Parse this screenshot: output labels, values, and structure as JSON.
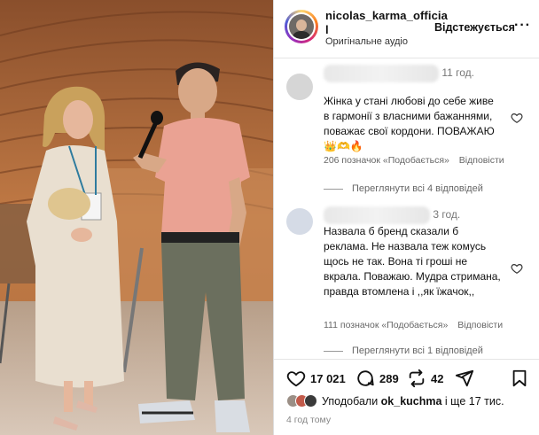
{
  "header": {
    "username": "nicolas_karma_officia l",
    "audio": "Оригінальне аудіо",
    "follow_label": "Відстежується",
    "more_icon": "more-dots-icon"
  },
  "comments": [
    {
      "time": "11 год.",
      "text": "Жінка у стані любові до себе живе в гармонії з власними бажаннями, поважає свої кордони. ПОВАЖАЮ 👑🫶🔥",
      "likes": "206 позначок «Подобається»",
      "reply": "Відповісти",
      "view_replies": "Переглянути всі 4 відповідей"
    },
    {
      "time": "3 год.",
      "text": "Назвала б бренд сказали б реклама. Не назвала теж комусь щось не так. Вона ті гроші не вкрала. Поважаю. Мудра стримана, правда втомлена і ,,як їжачок,,",
      "likes": "111 позначок «Подобається»",
      "reply": "Відповісти",
      "view_replies": "Переглянути всі 1 відповідей"
    }
  ],
  "actions": {
    "likes_count": "17 021",
    "comments_count": "289",
    "reposts_count": "42"
  },
  "liked_by": {
    "prefix": "Уподобали",
    "user": "ok_kuchma",
    "suffix": "і ще 17 тис."
  },
  "posted": "4 год тому",
  "colors": {
    "accent_gradient": [
      "#feda75",
      "#fa7e1e",
      "#d62976",
      "#962fbf",
      "#4f5bd5"
    ],
    "text": "#111111",
    "muted": "#777777"
  }
}
